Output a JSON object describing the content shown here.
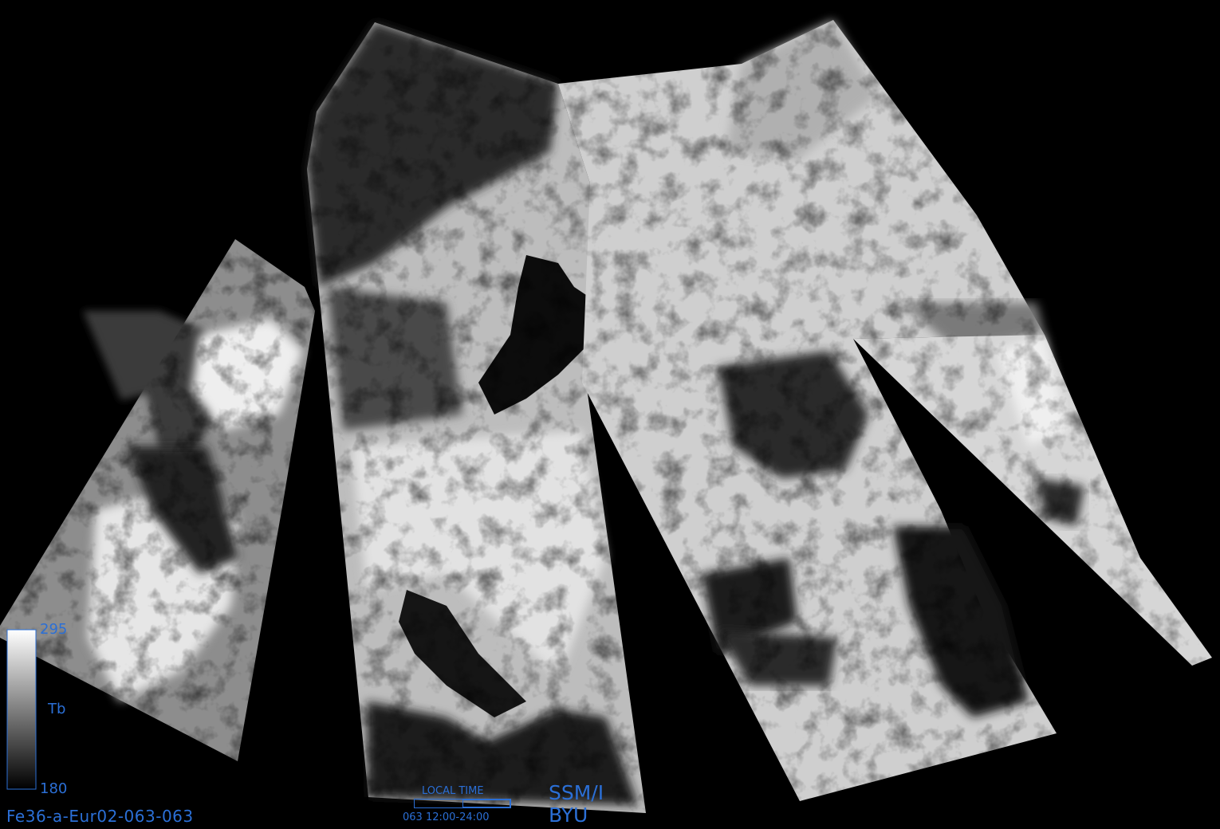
{
  "colorbar": {
    "max_label": "295",
    "min_label": "180",
    "variable_label": "Tb",
    "max_value": 295,
    "min_value": 180
  },
  "file_id": "Fe36-a-Eur02-063-063",
  "local_time": {
    "label": "LOCAL TIME",
    "range_text": "063 12:00-24:00",
    "selected_start_fraction": 0.5,
    "selected_end_fraction": 1.0
  },
  "sensor_label": "SSM/I",
  "org_label": "BYU",
  "colors": {
    "annotation": "#2b6fd6",
    "background": "#000000"
  }
}
